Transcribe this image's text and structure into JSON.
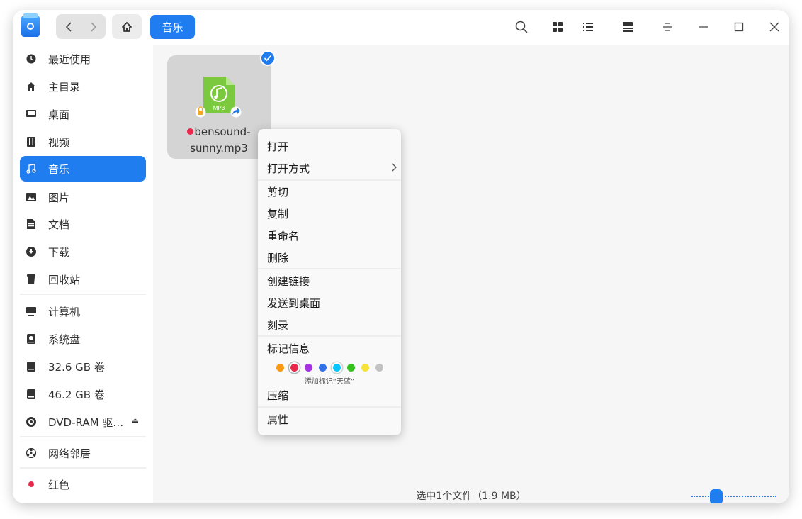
{
  "colors": {
    "accent": "#1f7df0",
    "music_file": "#7bc93e"
  },
  "titlebar": {
    "breadcrumb": "音乐",
    "icons": [
      "back-icon",
      "forward-icon",
      "home-icon",
      "search-icon",
      "icon-view-icon",
      "list-view-icon",
      "detail-view-icon",
      "menu-icon",
      "minimize-icon",
      "maximize-icon",
      "close-icon"
    ]
  },
  "sidebar": {
    "items": [
      {
        "label": "最近使用",
        "icon": "clock-icon"
      },
      {
        "label": "主目录",
        "icon": "home-icon"
      },
      {
        "label": "桌面",
        "icon": "desktop-icon"
      },
      {
        "label": "视频",
        "icon": "video-icon"
      },
      {
        "label": "音乐",
        "icon": "music-icon",
        "active": true
      },
      {
        "label": "图片",
        "icon": "picture-icon"
      },
      {
        "label": "文档",
        "icon": "document-icon"
      },
      {
        "label": "下载",
        "icon": "download-icon"
      },
      {
        "label": "回收站",
        "icon": "trash-icon"
      },
      {
        "label": "计算机",
        "icon": "computer-icon"
      },
      {
        "label": "系统盘",
        "icon": "system-disk-icon"
      },
      {
        "label": "32.6 GB 卷",
        "icon": "disk-icon"
      },
      {
        "label": "46.2 GB 卷",
        "icon": "disk-icon"
      },
      {
        "label": "DVD-RAM 驱…",
        "icon": "optical-drive-icon"
      },
      {
        "label": "网络邻居",
        "icon": "network-icon"
      },
      {
        "label": "红色",
        "icon": "red-tag-icon"
      }
    ]
  },
  "file": {
    "name_line1": "bensound-",
    "name_line2": "sunny.mp3",
    "type_badge": "MP3",
    "tag_color": "#e8294c"
  },
  "context_menu": {
    "items": [
      "打开",
      "打开方式",
      "剪切",
      "复制",
      "重命名",
      "删除",
      "创建链接",
      "发送到桌面",
      "刻录",
      "标记信息",
      "压缩",
      "属性"
    ],
    "tag_colors": [
      {
        "name": "orange",
        "hex": "#f79b16"
      },
      {
        "name": "red",
        "hex": "#e8294c"
      },
      {
        "name": "purple",
        "hex": "#a434e0"
      },
      {
        "name": "blue",
        "hex": "#3470e8"
      },
      {
        "name": "sky-blue",
        "hex": "#09c4ff"
      },
      {
        "name": "green",
        "hex": "#35c01f"
      },
      {
        "name": "yellow",
        "hex": "#f5e33b"
      },
      {
        "name": "gray",
        "hex": "#c2c2c2"
      }
    ],
    "tag_hint": "添加标记“天蓝”"
  },
  "status": {
    "text": "选中1个文件（1.9 MB）"
  },
  "zoom_slider": {
    "value": 0.2
  }
}
